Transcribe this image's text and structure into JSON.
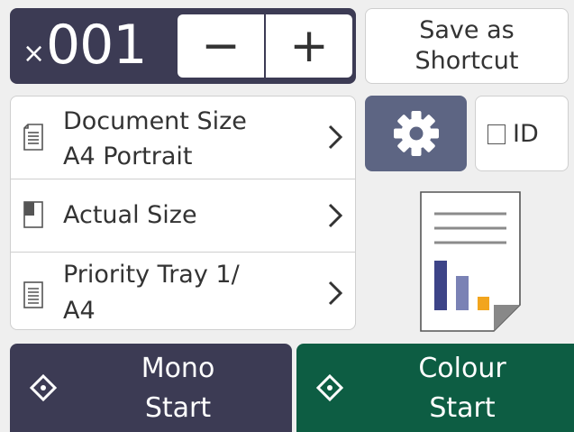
{
  "copies": {
    "prefix": "×",
    "value": "001",
    "decrement_label": "−",
    "increment_label": "+"
  },
  "shortcut": {
    "label": "Save as\nShortcut"
  },
  "settings": [
    {
      "icon": "document-size-icon",
      "line1": "Document Size",
      "line2": "A4 Portrait"
    },
    {
      "icon": "enlarge-reduce-icon",
      "line1": "Actual Size"
    },
    {
      "icon": "paper-tray-icon",
      "line1": "Priority Tray 1/",
      "line2": "A4"
    }
  ],
  "options": {
    "gear_icon": "gear-icon",
    "id_label": "ID",
    "id_checked": false
  },
  "preview": {
    "icon": "copy-preview-icon"
  },
  "start": {
    "mono": {
      "label": "Mono\nStart",
      "color": "#3c3b54"
    },
    "colour": {
      "label": "Colour\nStart",
      "color": "#0d5d43"
    }
  },
  "colors": {
    "dark": "#3c3b54",
    "gear": "#5d6583",
    "green": "#0d5d43",
    "background": "#efefef"
  }
}
